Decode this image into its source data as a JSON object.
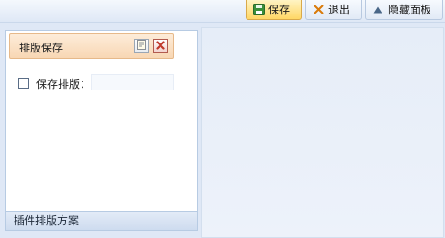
{
  "toolbar": {
    "save_label": "保存",
    "exit_label": "退出",
    "hide_panel_label": "隐藏面板"
  },
  "panel": {
    "item_label": "排版保存",
    "option_label": "保存排版：",
    "option_value": "",
    "footer_title": "插件排版方案"
  },
  "icons": {
    "save": "floppy-disk-icon",
    "exit": "close-x-icon",
    "hide": "triangle-up-icon",
    "edit": "document-edit-icon",
    "delete": "delete-x-icon"
  },
  "colors": {
    "save_button": "#ffd766",
    "item_highlight": "#f8d7b4",
    "workspace_bg": "#dfe8f6",
    "exit_icon": "#d97b0a",
    "delete_icon": "#c0392b"
  }
}
